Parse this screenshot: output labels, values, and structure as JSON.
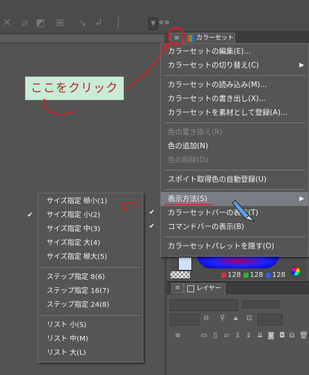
{
  "toolbar": {
    "collapse_glyph": "«»",
    "dropdown_glyph": "▼"
  },
  "color_set_panel": {
    "tab_label": "カラーセット",
    "menu_button_glyph": "≡"
  },
  "color_panel": {
    "rgb": [
      {
        "label": "128",
        "color": "#e03030"
      },
      {
        "label": "128",
        "color": "#30b040"
      },
      {
        "label": "128",
        "color": "#3060e0"
      }
    ]
  },
  "layer_panel": {
    "tab_label": "レイヤー",
    "menu_button_glyph": "≡"
  },
  "annotation": {
    "text": "ここをクリック",
    "color": "#c02020"
  },
  "main_menu": {
    "items": [
      {
        "label": "カラーセットの編集(E)...",
        "enabled": true
      },
      {
        "label": "カラーセットの切り替え(C)",
        "enabled": true,
        "submenu": true
      },
      {
        "sep": true
      },
      {
        "label": "カラーセットの読み込み(M)...",
        "enabled": true
      },
      {
        "label": "カラーセットの書き出し(X)...",
        "enabled": true
      },
      {
        "label": "カラーセットを素材として登録(A)...",
        "enabled": true
      },
      {
        "sep": true
      },
      {
        "label": "色の置き換え(R)",
        "enabled": false
      },
      {
        "label": "色の追加(N)",
        "enabled": true
      },
      {
        "label": "色の削除(D)",
        "enabled": false
      },
      {
        "sep": true
      },
      {
        "label": "スポイト取得色の自動登録(U)",
        "enabled": true
      },
      {
        "sep": true
      },
      {
        "label": "表示方法(S)",
        "enabled": true,
        "submenu": true,
        "highlighted": true
      },
      {
        "label": "カラーセットバーの表示(T)",
        "enabled": true,
        "checked": true
      },
      {
        "label": "コマンドバーの表示(B)",
        "enabled": true,
        "checked": true
      },
      {
        "sep": true
      },
      {
        "label": "カラーセットパレットを隠す(O)",
        "enabled": true
      }
    ]
  },
  "sub_menu": {
    "items": [
      {
        "label": "サイズ指定 極小(1)"
      },
      {
        "label": "サイズ指定 小(2)",
        "checked": true
      },
      {
        "label": "サイズ指定 中(3)"
      },
      {
        "label": "サイズ指定 大(4)"
      },
      {
        "label": "サイズ指定 極大(5)"
      },
      {
        "sep": true
      },
      {
        "label": "ステップ指定 8(6)"
      },
      {
        "label": "ステップ指定 16(7)"
      },
      {
        "label": "ステップ指定 24(8)"
      },
      {
        "sep": true
      },
      {
        "label": "リスト 小(S)"
      },
      {
        "label": "リスト 中(M)"
      },
      {
        "label": "リスト 大(L)"
      }
    ]
  }
}
